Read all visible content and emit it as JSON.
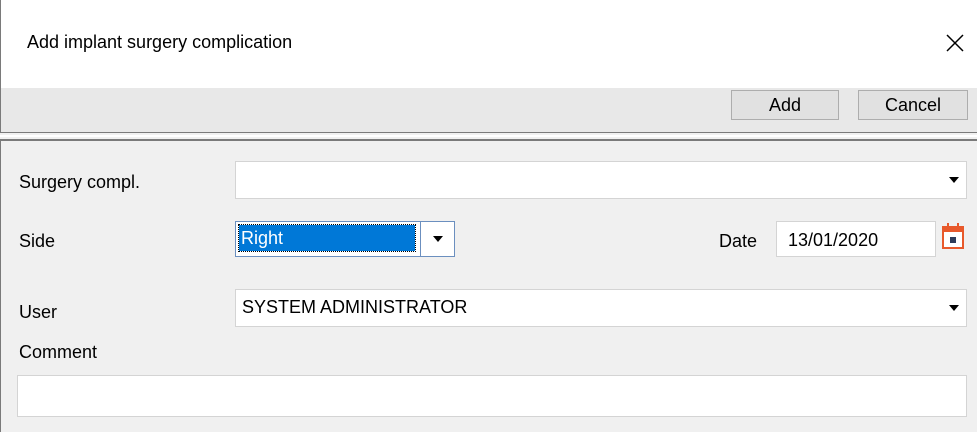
{
  "window": {
    "title": "Add implant surgery complication",
    "close_icon": "close-icon"
  },
  "toolbar": {
    "add_label": "Add",
    "cancel_label": "Cancel"
  },
  "form": {
    "surgery_compl": {
      "label": "Surgery compl.",
      "value": ""
    },
    "side": {
      "label": "Side",
      "value": "Right"
    },
    "date": {
      "label": "Date",
      "value": "13/01/2020",
      "icon": "calendar-icon",
      "icon_color": "#e8592b"
    },
    "user": {
      "label": "User",
      "value": "SYSTEM ADMINISTRATOR"
    },
    "comment": {
      "label": "Comment",
      "value": ""
    }
  },
  "colors": {
    "selection": "#0078d7",
    "dialog_bg": "#f0f0f0"
  }
}
